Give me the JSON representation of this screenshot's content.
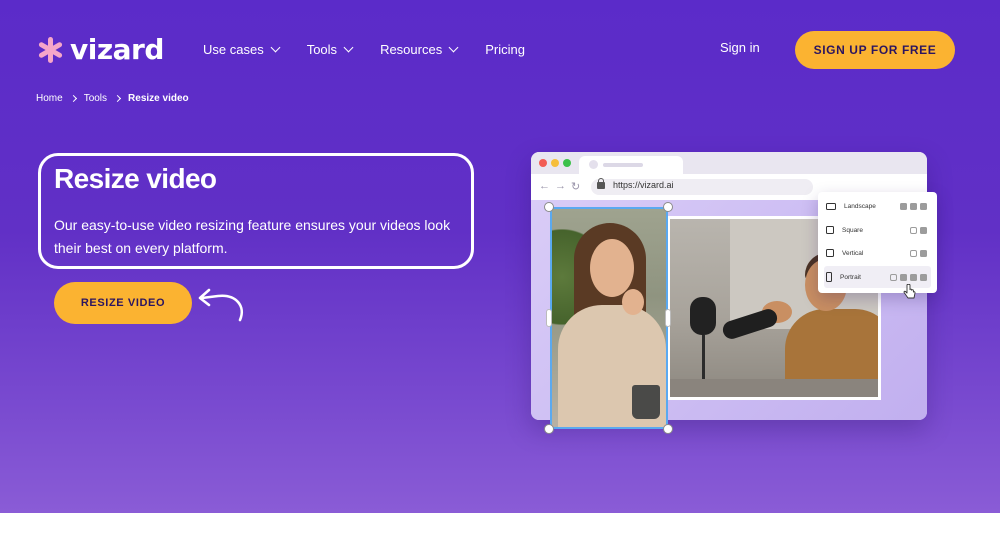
{
  "brand": {
    "name": "vizard"
  },
  "nav": {
    "items": [
      {
        "label": "Use cases"
      },
      {
        "label": "Tools"
      },
      {
        "label": "Resources"
      },
      {
        "label": "Pricing"
      }
    ],
    "signin": "Sign in",
    "signup": "SIGN UP FOR FREE"
  },
  "breadcrumb": {
    "home": "Home",
    "tools": "Tools",
    "current": "Resize video"
  },
  "hero": {
    "title": "Resize video",
    "description": "Our easy-to-use video resizing feature ensures your videos look their best on every platform.",
    "cta": "RESIZE VIDEO"
  },
  "mockup": {
    "url": "https://vizard.ai",
    "aspect_options": [
      {
        "label": "Landscape",
        "platforms": [
          "youtube-icon",
          "facebook-icon",
          "linkedin-icon"
        ]
      },
      {
        "label": "Square",
        "platforms": [
          "instagram-icon",
          "twitter-icon"
        ]
      },
      {
        "label": "Vertical",
        "platforms": [
          "instagram-icon",
          "facebook-icon"
        ]
      },
      {
        "label": "Portrait",
        "platforms": [
          "instagram-icon",
          "tiktok-icon",
          "facebook-icon",
          "youtube-icon"
        ]
      }
    ]
  },
  "colors": {
    "accent": "#fbb331",
    "hero_bg": "#5b2bc9",
    "logo_icon": "#f6a6c9",
    "selection": "#5aa9f0"
  }
}
